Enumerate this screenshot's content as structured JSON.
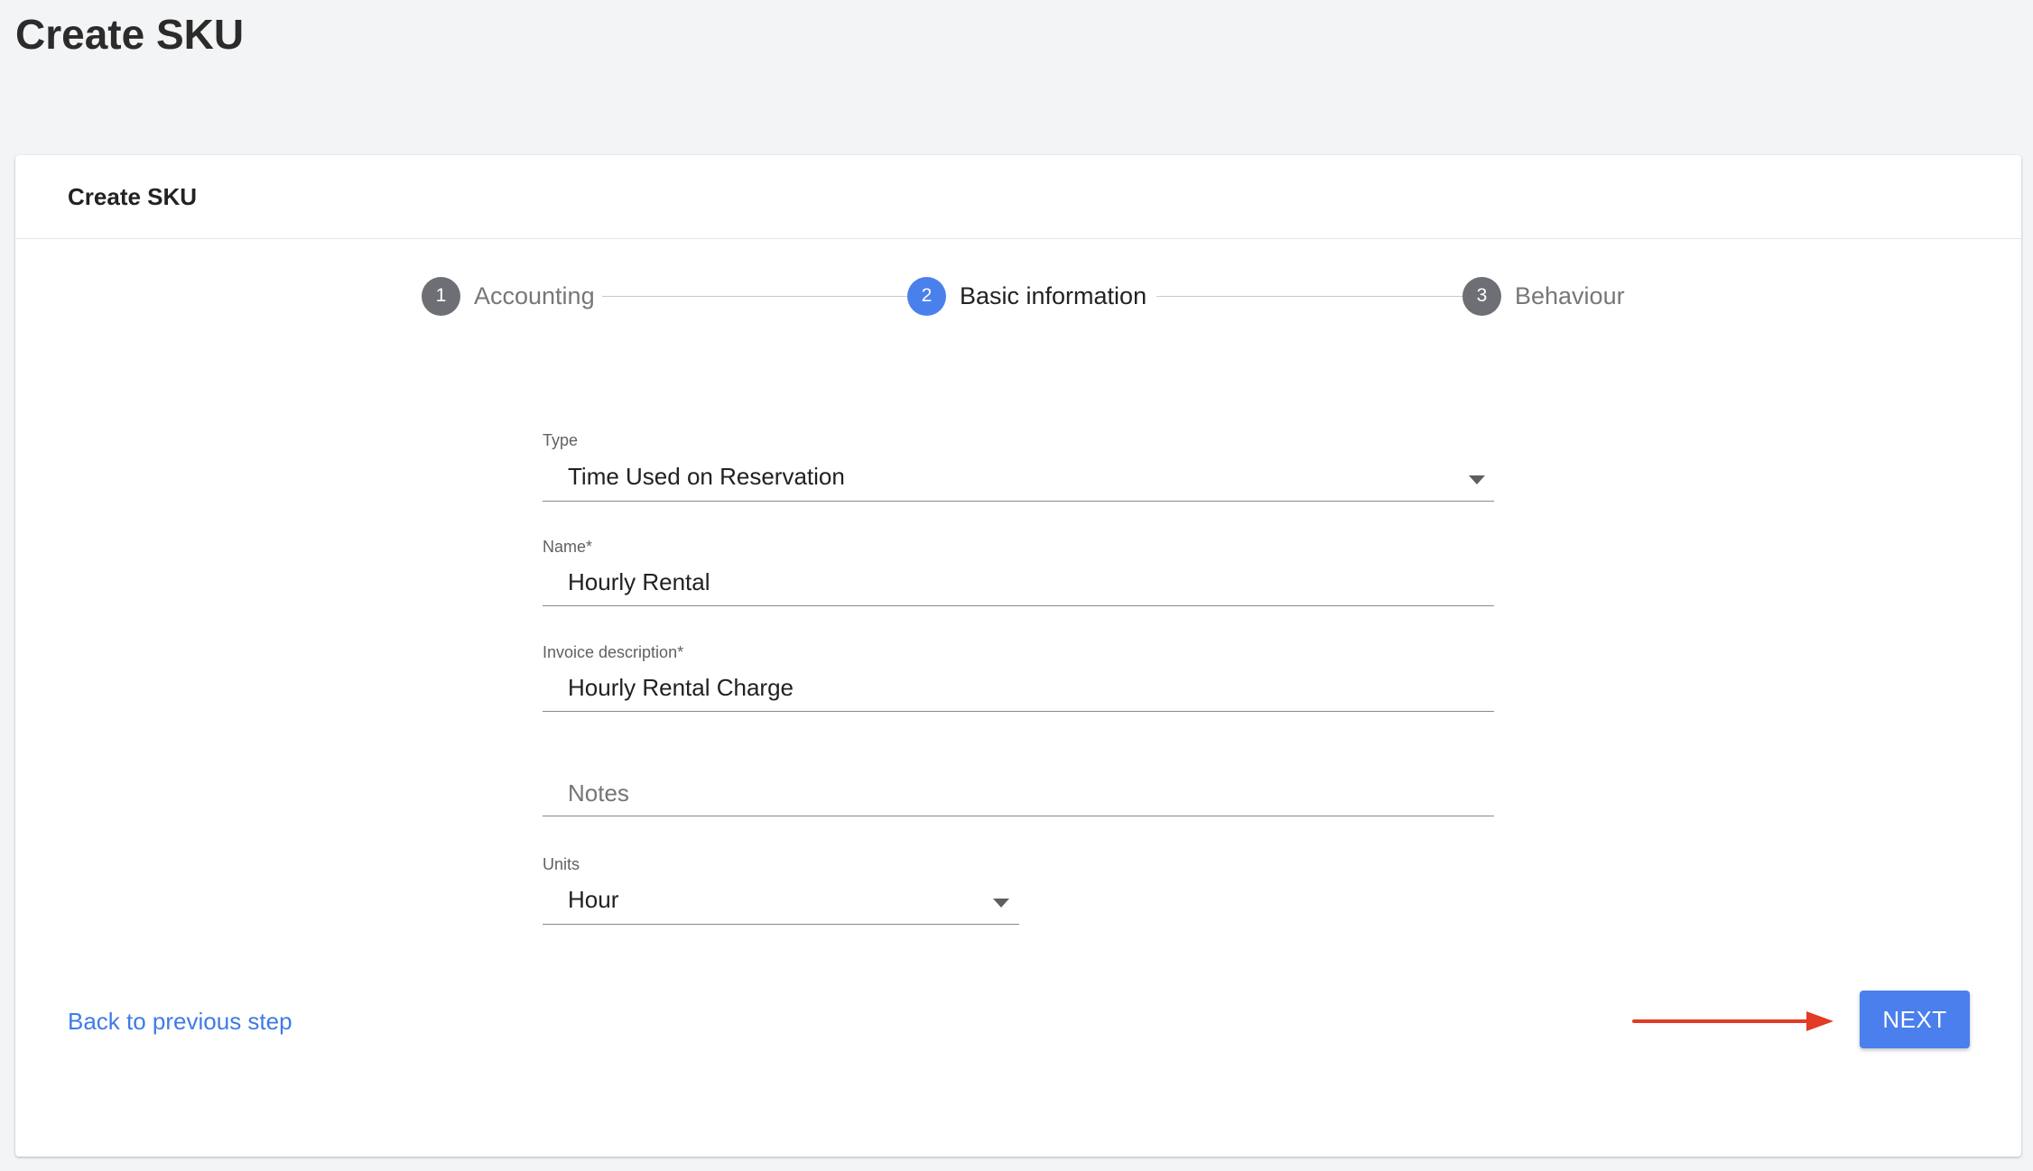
{
  "page": {
    "title": "Create SKU"
  },
  "card": {
    "title": "Create SKU"
  },
  "stepper": {
    "steps": [
      {
        "number": "1",
        "label": "Accounting",
        "state": "inactive"
      },
      {
        "number": "2",
        "label": "Basic information",
        "state": "active"
      },
      {
        "number": "3",
        "label": "Behaviour",
        "state": "inactive"
      }
    ]
  },
  "form": {
    "type": {
      "label": "Type",
      "value": "Time Used on Reservation"
    },
    "name": {
      "label": "Name*",
      "value": "Hourly Rental"
    },
    "invoice_description": {
      "label": "Invoice description*",
      "value": "Hourly Rental Charge"
    },
    "notes": {
      "placeholder": "Notes",
      "value": ""
    },
    "units": {
      "label": "Units",
      "value": "Hour"
    }
  },
  "actions": {
    "back_label": "Back to previous step",
    "next_label": "NEXT"
  },
  "colors": {
    "accent": "#4a7fed",
    "link": "#3f7be6",
    "annotation_arrow": "#e23b26"
  },
  "icons": {
    "type_dropdown": "caret-down-icon",
    "units_dropdown": "caret-down-icon",
    "annotation": "red-arrow-icon"
  }
}
